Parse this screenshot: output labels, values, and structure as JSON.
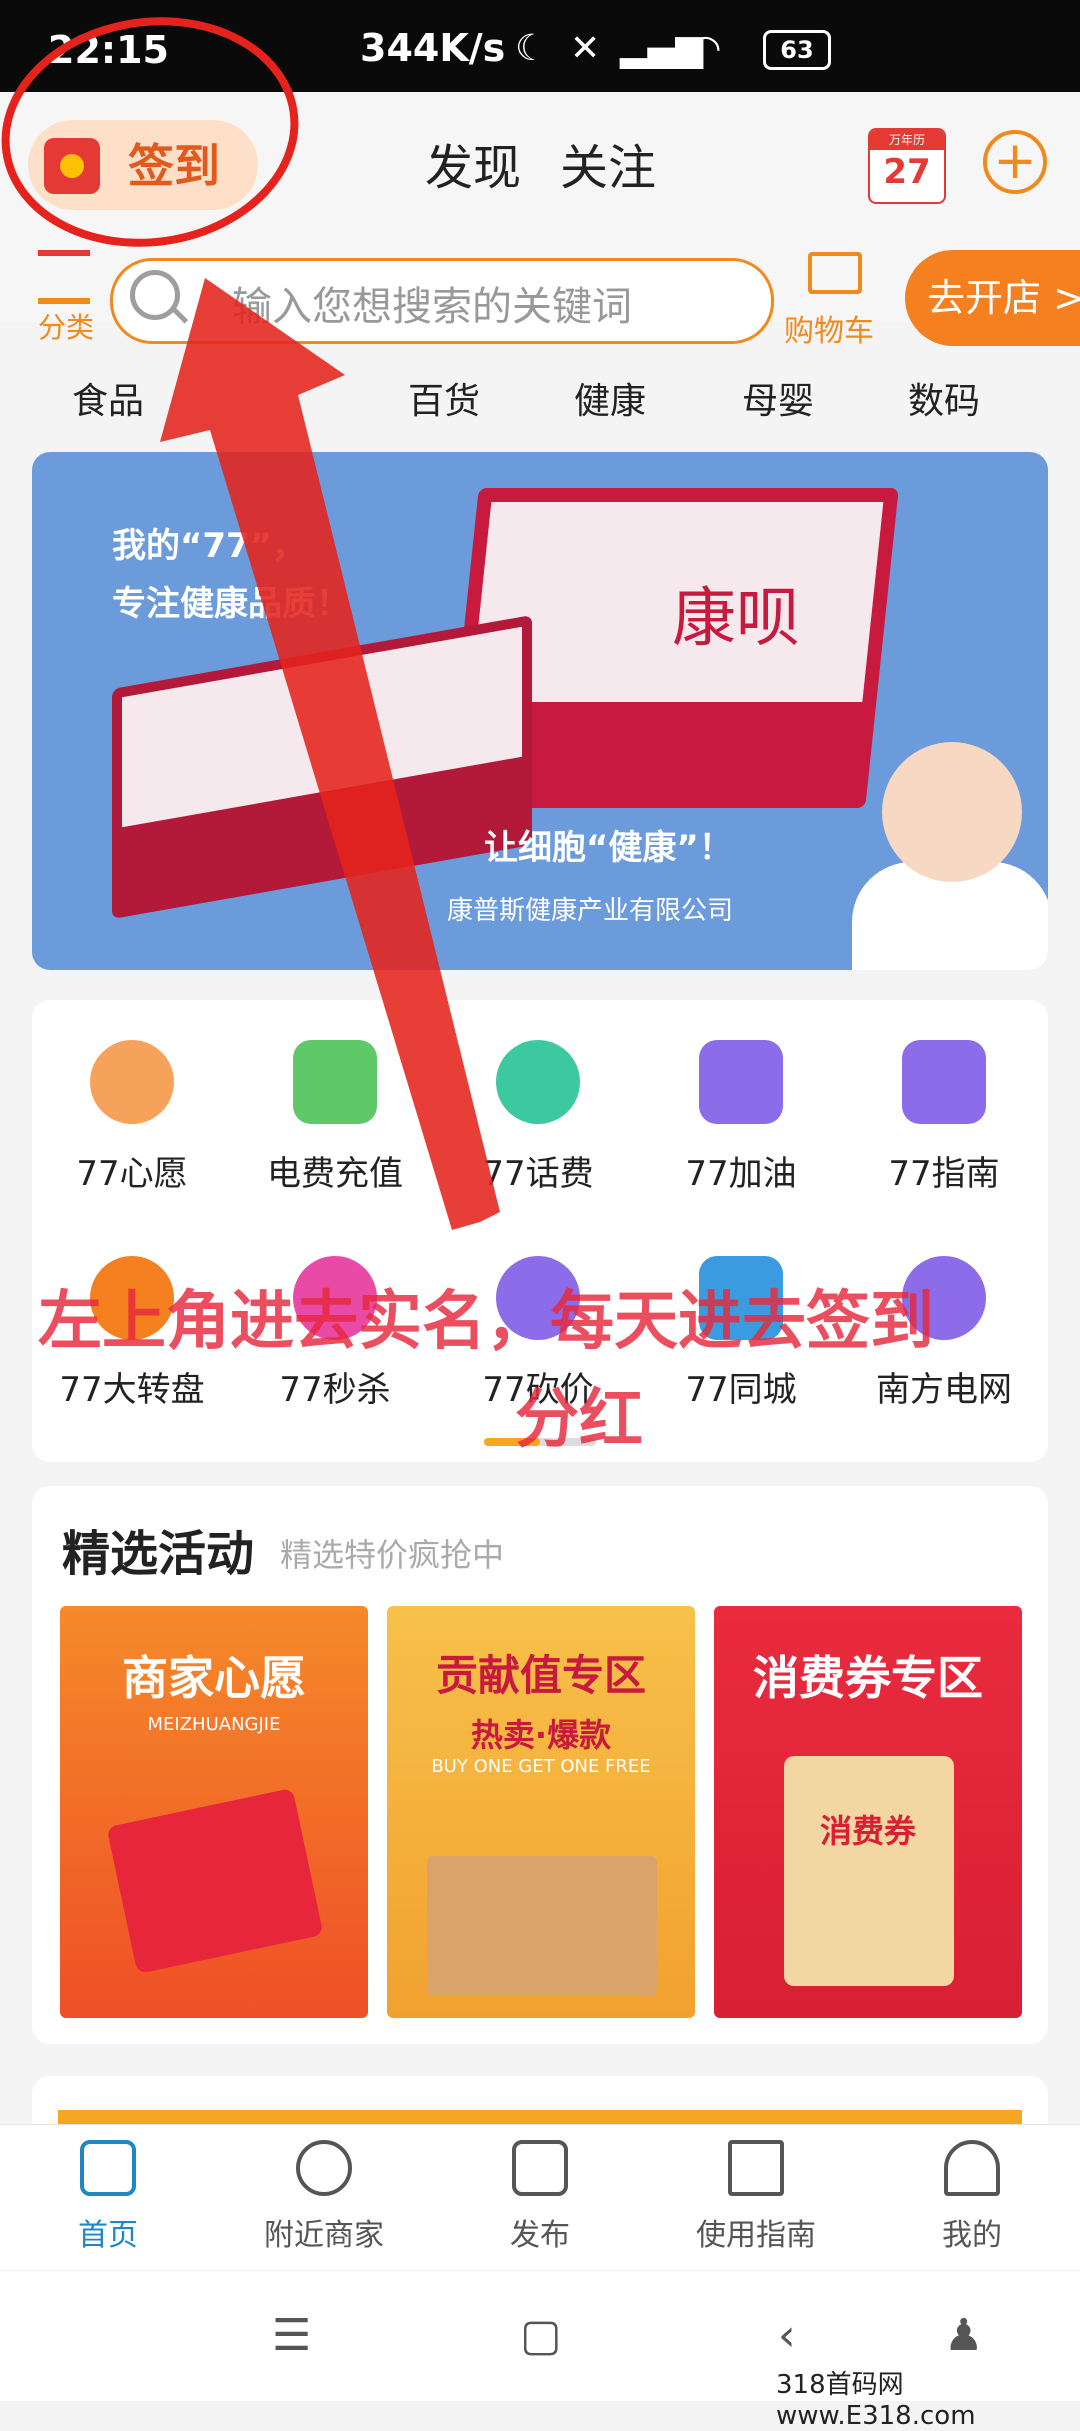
{
  "status_bar": {
    "time": "22:15",
    "network_speed": "344K/s",
    "battery": "63"
  },
  "header": {
    "sign_in_label": "签到",
    "tabs": [
      "发现",
      "关注"
    ],
    "calendar_day": "27",
    "calendar_header": "万年历"
  },
  "search_row": {
    "category_label": "分类",
    "placeholder": "输入您想搜索的关键词",
    "cart_label": "购物车",
    "open_shop_label": "去开店 >"
  },
  "categories": [
    "食品",
    "百货",
    "健康",
    "母婴",
    "数码"
  ],
  "banner": {
    "line1": "我的“77”，",
    "line2": "专注健康品质！",
    "line3": "让细胞“健康”！",
    "line4": "康普斯健康产业有限公司",
    "product_name": "康呗"
  },
  "grid": [
    {
      "label": "77心愿",
      "icon": "piggy-bank-icon",
      "color": "#f7a25a"
    },
    {
      "label": "电费充值",
      "icon": "electricity-bill-icon",
      "color": "#5fc96a"
    },
    {
      "label": "77话费",
      "icon": "phone-icon",
      "color": "#3cc9a0"
    },
    {
      "label": "77加油",
      "icon": "fuel-pump-icon",
      "color": "#8c6ce8"
    },
    {
      "label": "77指南",
      "icon": "home-icon",
      "color": "#8c6ce8"
    },
    {
      "label": "77大转盘",
      "icon": "wheel-icon",
      "color": "#f5801f"
    },
    {
      "label": "77秒杀",
      "icon": "flash-sale-icon",
      "color": "#e84aa5"
    },
    {
      "label": "77砍价",
      "icon": "bargain-icon",
      "color": "#8c6ce8"
    },
    {
      "label": "77同城",
      "icon": "city-icon",
      "color": "#3a9be0"
    },
    {
      "label": "南方电网",
      "icon": "grid-power-icon",
      "color": "#8c6ce8"
    }
  ],
  "annotation": {
    "line1": "左上角进去实名，每天进去签到",
    "line2": "分红"
  },
  "activities": {
    "title": "精选活动",
    "subtitle": "精选特价疯抢中",
    "cards": [
      {
        "title": "商家心愿",
        "sub": "MEIZHUANGJIE",
        "bg": "#f06a2a"
      },
      {
        "title": "贡献值专区",
        "sub": "热卖·爆款",
        "sub2": "BUY ONE GET ONE FREE",
        "bg": "#f4b33a"
      },
      {
        "title": "消费券专区",
        "sub": "消费券",
        "bg": "#e8243a"
      }
    ]
  },
  "bottom_nav": [
    "首页",
    "附近商家",
    "发布",
    "使用指南",
    "我的"
  ],
  "watermark": "318首码网 www.E318.com",
  "colors": {
    "accent": "#f5801f",
    "active_nav": "#1f88c2",
    "annotation": "#e6283c"
  }
}
